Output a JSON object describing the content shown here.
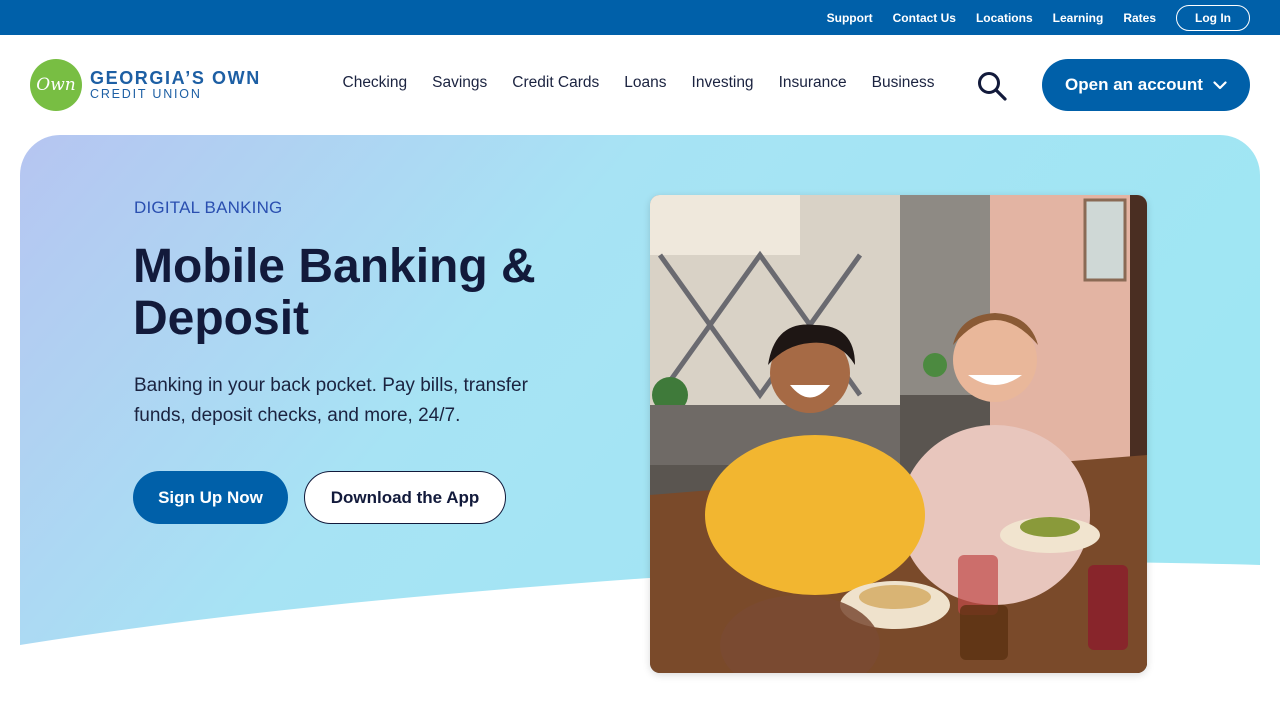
{
  "utility_nav": {
    "links": [
      "Support",
      "Contact Us",
      "Locations",
      "Learning",
      "Rates"
    ],
    "login_label": "Log In"
  },
  "logo": {
    "badge_text": "Own",
    "line1": "GEORGIA’S OWN",
    "line2": "CREDIT UNION"
  },
  "primary_nav": {
    "items": [
      "Checking",
      "Savings",
      "Credit Cards",
      "Loans",
      "Investing",
      "Insurance",
      "Business"
    ],
    "cta_label": "Open an account",
    "search_icon": "search-icon"
  },
  "hero": {
    "eyebrow": "DIGITAL BANKING",
    "title": "Mobile Banking & Deposit",
    "subtitle": "Banking in your back pocket. Pay bills, transfer funds, deposit checks, and more, 24/7.",
    "primary_cta": "Sign Up Now",
    "secondary_cta": "Download the App"
  },
  "colors": {
    "brand_blue": "#0060a9",
    "brand_green": "#78be43",
    "hero_gradient_start": "#b3c6f2",
    "hero_gradient_end": "#a3e6f5",
    "heading": "#121a3b"
  }
}
